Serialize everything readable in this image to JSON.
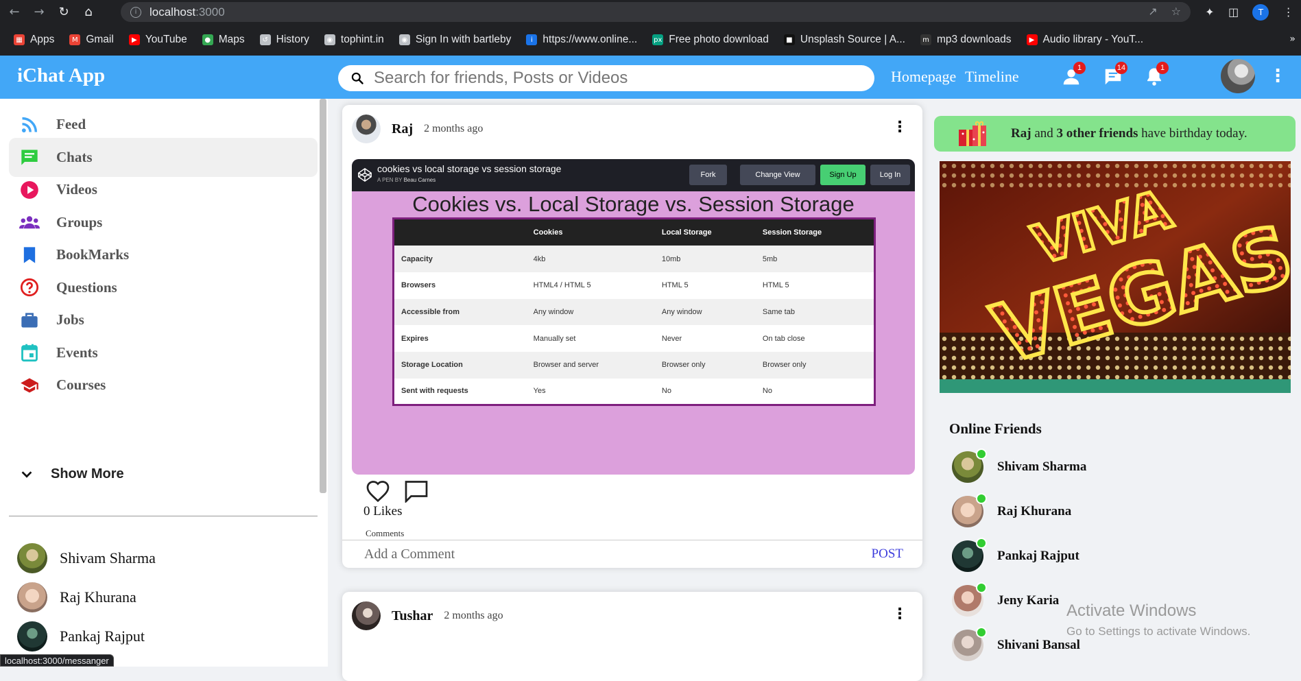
{
  "browser": {
    "url_host": "localhost",
    "url_port": ":3000",
    "profile_initial": "T",
    "bookmarks": [
      {
        "label": "Apps",
        "icon": "apps-grid-icon",
        "color": "#ea4335"
      },
      {
        "label": "Gmail",
        "icon": "gmail-icon",
        "color": "#ea4335"
      },
      {
        "label": "YouTube",
        "icon": "youtube-icon",
        "color": "#ff0000"
      },
      {
        "label": "Maps",
        "icon": "maps-pin-icon",
        "color": "#34a853"
      },
      {
        "label": "History",
        "icon": "history-icon",
        "color": "#bdc1c6"
      },
      {
        "label": "tophint.in",
        "icon": "globe-icon",
        "color": "#bdc1c6"
      },
      {
        "label": "Sign In with bartleby",
        "icon": "globe-icon",
        "color": "#bdc1c6"
      },
      {
        "label": "https://www.online...",
        "icon": "info-icon",
        "color": "#1a73e8"
      },
      {
        "label": "Free photo download",
        "icon": "px-icon",
        "color": "#05a081"
      },
      {
        "label": "Unsplash Source | A...",
        "icon": "unsplash-icon",
        "color": "#111111"
      },
      {
        "label": "mp3 downloads",
        "icon": "m-icon",
        "color": "#333333"
      },
      {
        "label": "Audio library - YouT...",
        "icon": "youtube-icon",
        "color": "#ff0000"
      }
    ],
    "bookmarks_more": "»",
    "status_tooltip": "localhost:3000/messanger"
  },
  "header": {
    "logo": "iChat App",
    "search_placeholder": "Search for friends, Posts or Videos",
    "links": [
      "Homepage",
      "Timeline"
    ],
    "badges": {
      "friends": "1",
      "messages": "14",
      "notifications": "1"
    },
    "accent_color": "#42a7f7"
  },
  "sidebar": {
    "items": [
      {
        "label": "Feed",
        "icon": "rss-feed-icon",
        "color": "#42a7f7"
      },
      {
        "label": "Chats",
        "icon": "chat-icon",
        "color": "#2ecc40"
      },
      {
        "label": "Videos",
        "icon": "play-circle-icon",
        "color": "#e8175d"
      },
      {
        "label": "Groups",
        "icon": "groups-icon",
        "color": "#7b2fbf"
      },
      {
        "label": "BookMarks",
        "icon": "bookmark-icon",
        "color": "#1e6fe0"
      },
      {
        "label": "Questions",
        "icon": "help-circle-icon",
        "color": "#e02020"
      },
      {
        "label": "Jobs",
        "icon": "briefcase-icon",
        "color": "#3a6db5"
      },
      {
        "label": "Events",
        "icon": "calendar-icon",
        "color": "#1fc1c1"
      },
      {
        "label": "Courses",
        "icon": "school-cap-icon",
        "color": "#cc1c1c"
      }
    ],
    "active_index": 1,
    "show_more": "Show More",
    "friends": [
      "Shivam Sharma",
      "Raj Khurana",
      "Pankaj Rajput"
    ]
  },
  "feed": {
    "posts": [
      {
        "author": "Raj",
        "time": "2 months ago",
        "likes": "0 Likes",
        "comments_label": "Comments",
        "comment_placeholder": "Add a Comment",
        "post_label": "POST",
        "image": {
          "pen_title": "cookies vs local storage vs session storage",
          "pen_by_label": "A PEN BY",
          "pen_author": "Beau Carnes",
          "buttons": [
            "Fork",
            "Change View",
            "Sign Up",
            "Log In"
          ],
          "heading": "Cookies vs. Local Storage vs. Session Storage",
          "table_headers": [
            "",
            "Cookies",
            "Local Storage",
            "Session Storage"
          ],
          "table_rows": [
            [
              "Capacity",
              "4kb",
              "10mb",
              "5mb"
            ],
            [
              "Browsers",
              "HTML4 / HTML 5",
              "HTML 5",
              "HTML 5"
            ],
            [
              "Accessible from",
              "Any window",
              "Any window",
              "Same tab"
            ],
            [
              "Expires",
              "Manually set",
              "Never",
              "On tab close"
            ],
            [
              "Storage Location",
              "Browser and server",
              "Browser only",
              "Browser only"
            ],
            [
              "Sent with requests",
              "Yes",
              "No",
              "No"
            ]
          ]
        }
      },
      {
        "author": "Tushar",
        "time": "2 months ago"
      }
    ]
  },
  "rightbar": {
    "birthday": {
      "name": "Raj",
      "and": "and",
      "others": "3 other friends",
      "suffix": "have birthday today."
    },
    "ad_text": [
      "VIVA",
      "VEGAS"
    ],
    "online_title": "Online Friends",
    "online_friends": [
      "Shivam Sharma",
      "Raj Khurana",
      "Pankaj Rajput",
      "Jeny Karia",
      "Shivani Bansal"
    ]
  },
  "watermark": {
    "line1": "Activate Windows",
    "line2": "Go to Settings to activate Windows."
  }
}
